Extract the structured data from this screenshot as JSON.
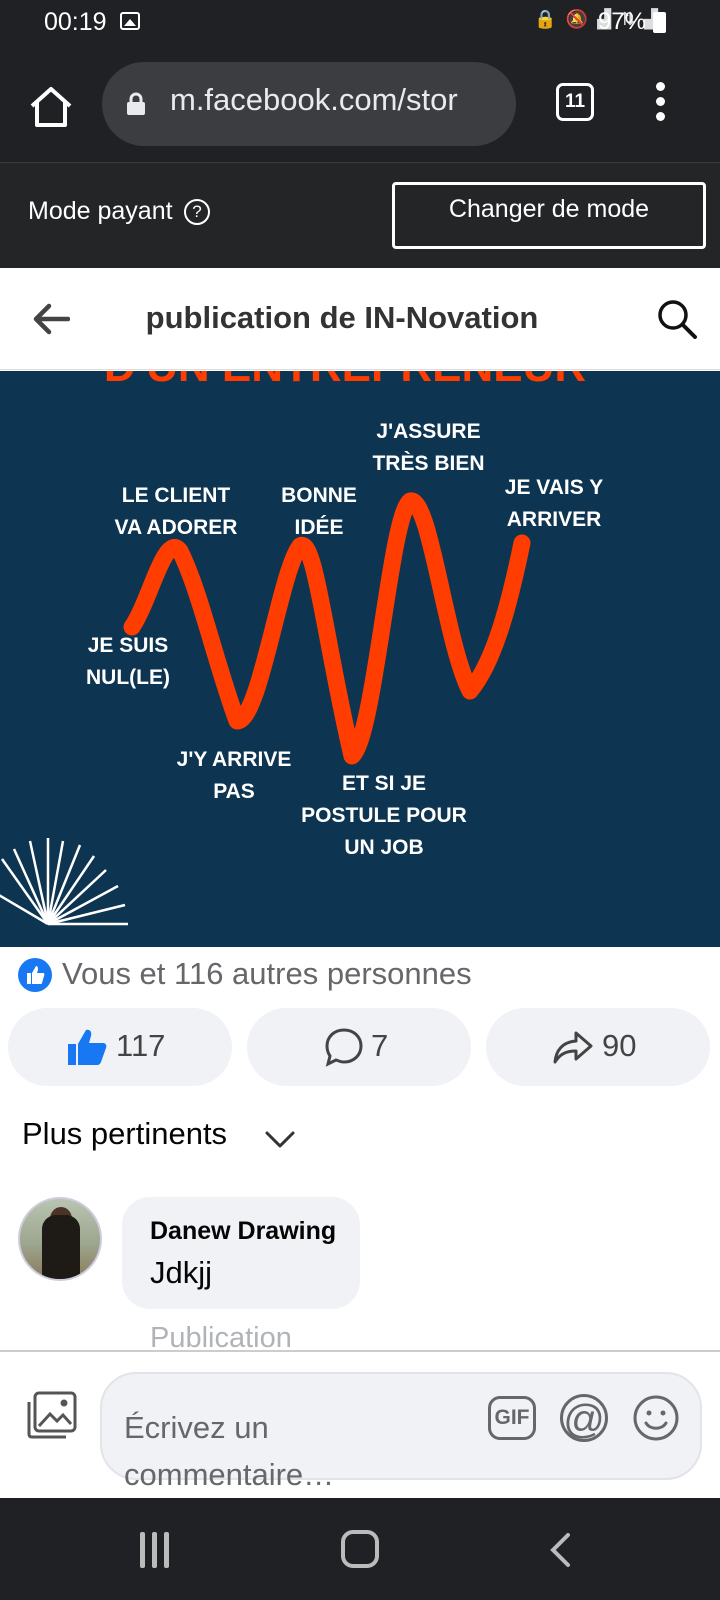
{
  "status_bar": {
    "time": "00:19",
    "battery": "97%"
  },
  "browser": {
    "url": "m.facebook.com/stor",
    "tab_count": "11"
  },
  "mode_bar": {
    "label": "Mode payant",
    "button": "Changer de mode"
  },
  "header": {
    "title": "publication de IN-Novation"
  },
  "post_image": {
    "cut_heading": "D'UN ENTREPRENEUR",
    "labels": {
      "client": "LE CLIENT\nVA ADORER",
      "nul": "JE SUIS\nNUL(LE)",
      "arrive_pas": "J'Y ARRIVE\nPAS",
      "bonne_idee": "BONNE\nIDÉE",
      "postule": "ET SI JE\nPOSTULE POUR\nUN JOB",
      "assure": "J'ASSURE\nTRÈS BIEN",
      "arriver": "JE VAIS Y\nARRIVER"
    },
    "colors": {
      "background": "#0d3450",
      "line": "#ff3d00"
    }
  },
  "reactions": {
    "summary": "Vous et 116 autres personnes"
  },
  "actions": {
    "like_count": "117",
    "comment_count": "7",
    "share_count": "90"
  },
  "comments_sort": {
    "label": "Plus pertinents"
  },
  "comment": {
    "author": "Danew Drawing",
    "text": "Jdkjj",
    "meta": "Publication"
  },
  "composer": {
    "placeholder": "Écrivez un commentaire…",
    "gif": "GIF",
    "at": "@"
  },
  "colors": {
    "facebook_blue": "#1877f2",
    "dark_bar": "#202124"
  }
}
